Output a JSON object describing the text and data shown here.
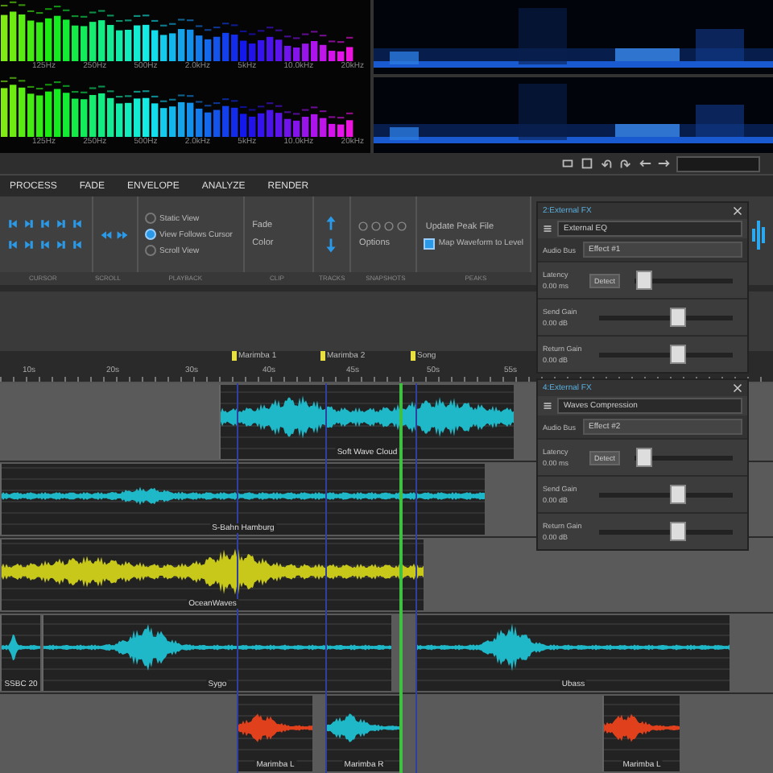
{
  "analyzer": {
    "freq_labels_top": [
      "125Hz",
      "250Hz",
      "500Hz",
      "2.0kHz",
      "5kHz",
      "10.0kHz",
      "20kHz"
    ],
    "freq_labels_bottom": [
      "125Hz",
      "250Hz",
      "500Hz",
      "2.0kHz",
      "5kHz",
      "10.0kHz",
      "20kHz"
    ]
  },
  "ribbon": {
    "tabs": [
      {
        "label": "PROCESS",
        "selected": false
      },
      {
        "label": "FADE",
        "selected": false
      },
      {
        "label": "ENVELOPE",
        "selected": false
      },
      {
        "label": "ANALYZE",
        "selected": false
      },
      {
        "label": "RENDER",
        "selected": false
      }
    ],
    "group_labels": [
      "CURSOR",
      "SCROLL",
      "PLAYBACK",
      "CLIP",
      "TRACKS",
      "SNAPSHOTS",
      "PEAKS"
    ],
    "playback_options": [
      {
        "label": "Static View",
        "selected": false
      },
      {
        "label": "View Follows Cursor",
        "selected": true
      },
      {
        "label": "Scroll View",
        "selected": false
      }
    ],
    "clip_buttons": [
      "Fade",
      "Color"
    ],
    "options_button": "Options",
    "peaks_button": "Update Peak File",
    "map_waveform": {
      "label": "Map Waveform to Level",
      "checked": true
    }
  },
  "fx_panels": [
    {
      "title": "2:External FX",
      "plugin": "External EQ",
      "bus_label": "Audio Bus",
      "bus": "Effect #1",
      "latency_value": "0.00",
      "latency_unit": "ms",
      "detect_button": "Detect",
      "params": [
        {
          "label": "Latency",
          "level": 0.02
        },
        {
          "label": "Send Gain",
          "value": "0.00",
          "unit": "dB",
          "level": 0.6
        },
        {
          "label": "Return Gain",
          "value": "0.00",
          "unit": "dB",
          "level": 0.6
        }
      ]
    },
    {
      "title": "4:External FX",
      "plugin": "Waves Compression",
      "bus_label": "Audio Bus",
      "bus": "Effect #2",
      "latency_value": "0.00",
      "latency_unit": "ms",
      "detect_button": "Detect",
      "params": [
        {
          "label": "Latency",
          "level": 0.02
        },
        {
          "label": "Send Gain",
          "value": "0.00",
          "unit": "dB",
          "level": 0.6
        },
        {
          "label": "Return Gain",
          "value": "0.00",
          "unit": "dB",
          "level": 0.6
        }
      ]
    }
  ],
  "timeline": {
    "ruler": [
      "10s",
      "20s",
      "30s",
      "40s",
      "45s",
      "50s",
      "55s"
    ],
    "markers": [
      "Marimba 1",
      "Marimba 2",
      "Song"
    ]
  },
  "tracks": [
    {
      "clips": [
        {
          "label": "Soft Wave Cloud",
          "color": "#1fb8c8"
        }
      ]
    },
    {
      "clips": [
        {
          "label": "S-Bahn Hamburg",
          "color": "#1fb8c8"
        }
      ]
    },
    {
      "clips": [
        {
          "label": "OceanWaves",
          "color": "#c8c81a"
        }
      ]
    },
    {
      "clips": [
        {
          "label": "SSBC 20",
          "color": "#1fb8c8"
        },
        {
          "label": "Sygo",
          "color": "#1fb8c8"
        },
        {
          "label": "Ubass",
          "color": "#1fb8c8"
        }
      ]
    },
    {
      "clips": [
        {
          "label": "Marimba L",
          "color": "#e0401c"
        },
        {
          "label": "Marimba R",
          "color": "#1fb8c8"
        },
        {
          "label": "Marimba L",
          "color": "#e0401c"
        }
      ]
    }
  ]
}
